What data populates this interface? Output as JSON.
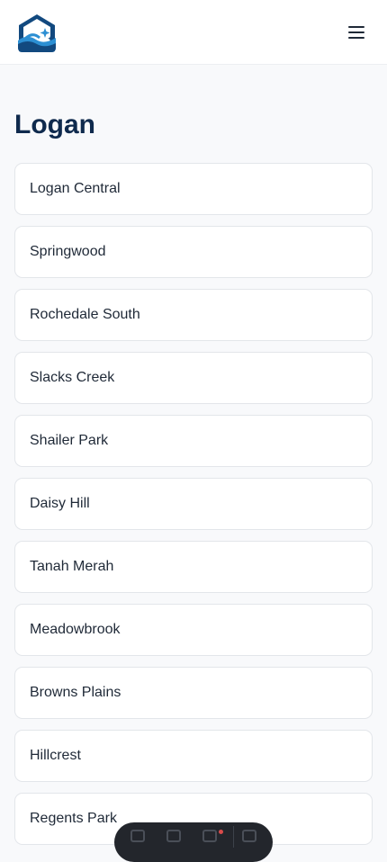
{
  "header": {
    "logo_icon": "home-wave-logo-icon",
    "menu_icon": "hamburger-menu-icon"
  },
  "page": {
    "title": "Logan"
  },
  "suburbs": [
    "Logan Central",
    "Springwood",
    "Rochedale South",
    "Slacks Creek",
    "Shailer Park",
    "Daisy Hill",
    "Tanah Merah",
    "Meadowbrook",
    "Browns Plains",
    "Hillcrest",
    "Regents Park"
  ],
  "colors": {
    "title": "#0f2a4d",
    "logo_navy": "#12497f",
    "logo_blue": "#2c8fd3",
    "background": "#f8f9fb"
  }
}
